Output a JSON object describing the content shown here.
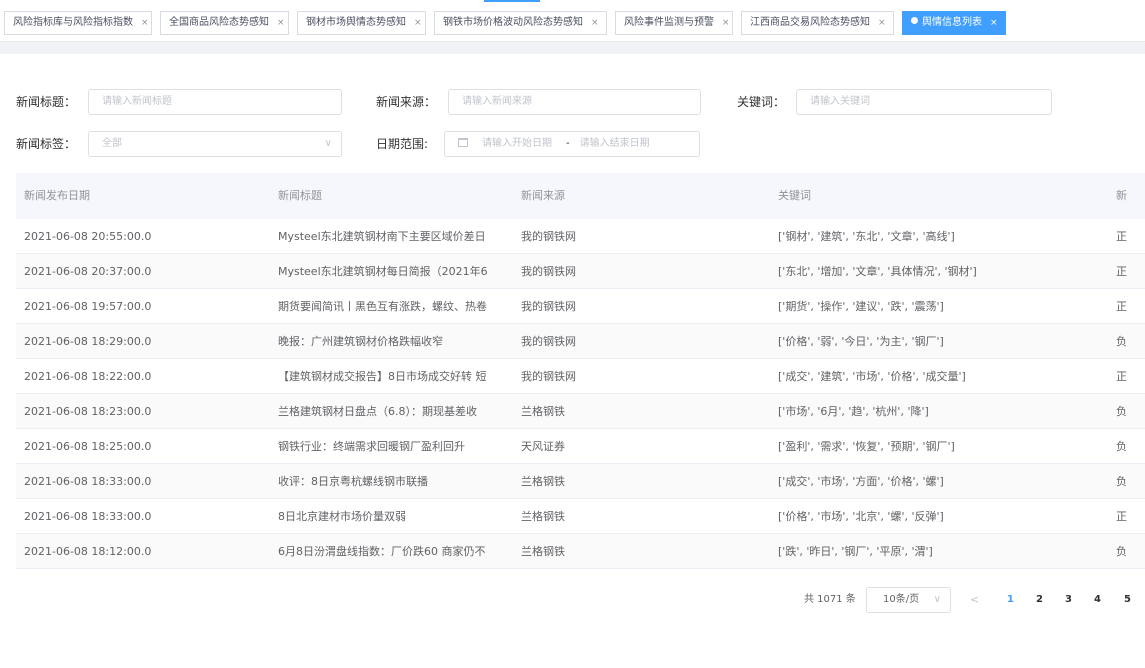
{
  "tabs": [
    {
      "label": "风险指标库与风险指标指数",
      "active": false
    },
    {
      "label": "全国商品风险态势感知",
      "active": false
    },
    {
      "label": "钢材市场舆情态势感知",
      "active": false
    },
    {
      "label": "钢铁市场价格波动风险态势感知",
      "active": false
    },
    {
      "label": "风险事件监测与预警",
      "active": false
    },
    {
      "label": "江西商品交易风险态势感知",
      "active": false
    },
    {
      "label": "舆情信息列表",
      "active": true
    }
  ],
  "tab_close_glyph": "×",
  "accent_color": "#409eff",
  "filters": {
    "title_label": "新闻标题：",
    "title_placeholder": "请输入新闻标题",
    "source_label": "新闻来源：",
    "source_placeholder": "请输入新闻来源",
    "keyword_label": "关键词：",
    "keyword_placeholder": "请输入关键词",
    "tag_label": "新闻标签：",
    "tag_value": "全部",
    "date_label": "日期范围:",
    "date_start_placeholder": "请输入开始日期",
    "date_separator": "-",
    "date_end_placeholder": "请输入结束日期"
  },
  "table": {
    "headers": [
      "新闻发布日期",
      "新闻标题",
      "新闻来源",
      "关键词",
      "新"
    ],
    "rows": [
      [
        "2021-06-08 20:55:00.0",
        "Mysteel东北建筑钢材南下主要区域价差日",
        "我的钢铁网",
        "['钢材', '建筑', '东北', '文章', '高线']",
        "正"
      ],
      [
        "2021-06-08 20:37:00.0",
        "Mysteel东北建筑钢材每日简报（2021年6",
        "我的钢铁网",
        "['东北', '增加', '文章', '具体情况', '钢材']",
        "正"
      ],
      [
        "2021-06-08 19:57:00.0",
        "期货要闻简讯丨黑色互有涨跌，螺纹、热卷",
        "我的钢铁网",
        "['期货', '操作', '建议', '跌', '震荡']",
        "正"
      ],
      [
        "2021-06-08 18:29:00.0",
        "晚报：广州建筑钢材价格跌幅收窄",
        "我的钢铁网",
        "['价格', '弱', '今日', '为主', '钢厂']",
        "负"
      ],
      [
        "2021-06-08 18:22:00.0",
        "【建筑钢材成交报告】8日市场成交好转 短",
        "我的钢铁网",
        "['成交', '建筑', '市场', '价格', '成交量']",
        "正"
      ],
      [
        "2021-06-08 18:23:00.0",
        "兰格建筑钢材日盘点（6.8）：期现基差收",
        "兰格钢铁",
        "['市场', '6月', '趋', '杭州', '降']",
        "负"
      ],
      [
        "2021-06-08 18:25:00.0",
        "钢铁行业：终端需求回暖钢厂盈利回升",
        "天风证券",
        "['盈利', '需求', '恢复', '预期', '钢厂']",
        "负"
      ],
      [
        "2021-06-08 18:33:00.0",
        "收评：8日京粤杭螺线钢市联播",
        "兰格钢铁",
        "['成交', '市场', '方面', '价格', '螺']",
        "负"
      ],
      [
        "2021-06-08 18:33:00.0",
        "8日北京建材市场价量双弱",
        "兰格钢铁",
        "['价格', '市场', '北京', '螺', '反弹']",
        "正"
      ],
      [
        "2021-06-08 18:12:00.0",
        "6月8日汾渭盘线指数：厂价跌60 商家仍不",
        "兰格钢铁",
        "['跌', '昨日', '钢厂', '平原', '渭']",
        "负"
      ]
    ]
  },
  "pagination": {
    "total_text": "共 1071 条",
    "page_size": "10条/页",
    "prev_glyph": "<",
    "pages": [
      "1",
      "2",
      "3",
      "4",
      "5"
    ],
    "current_page": "1"
  }
}
